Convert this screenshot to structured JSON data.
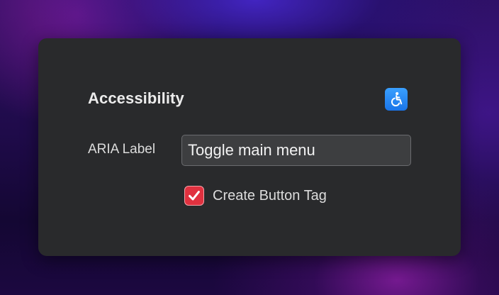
{
  "panel": {
    "section_title": "Accessibility",
    "section_icon": "accessibility-icon",
    "aria_label": {
      "label": "ARIA Label",
      "value": "Toggle main menu"
    },
    "button_tag": {
      "label": "Create Button Tag",
      "checked": true
    }
  },
  "colors": {
    "checkbox_accent": "#e0313f",
    "icon_accent": "#1a74e8",
    "panel_background": "#292a2c"
  }
}
